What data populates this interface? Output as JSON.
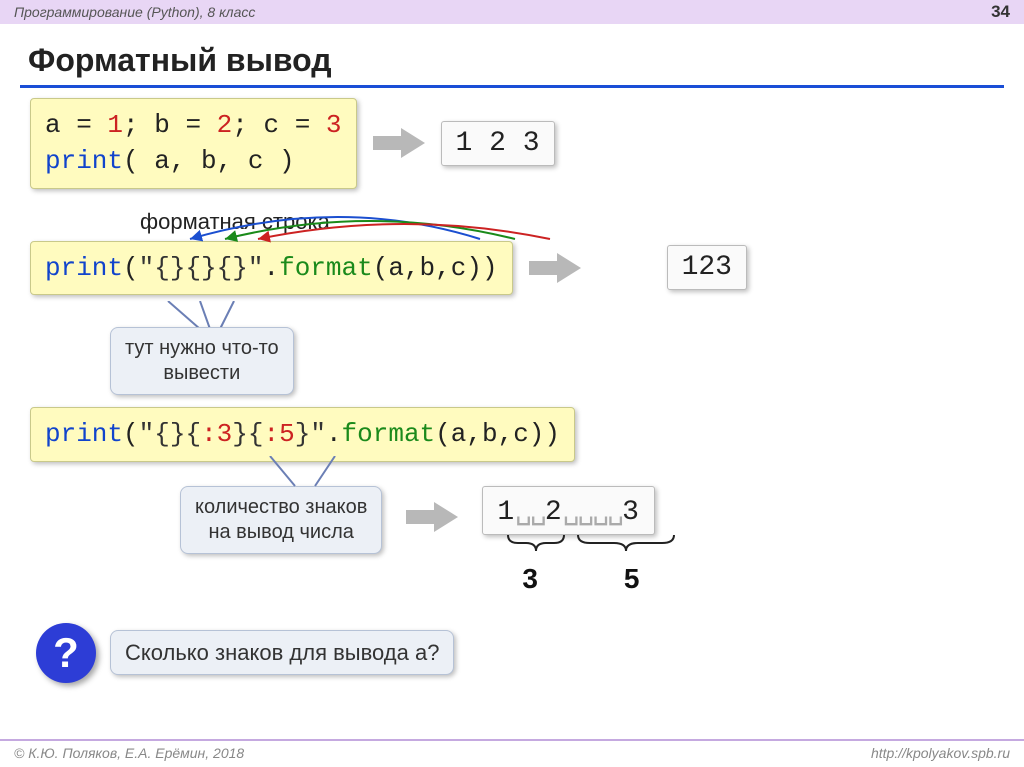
{
  "header": {
    "course": "Программирование (Python), 8 класс",
    "page": "34"
  },
  "title": "Форматный вывод",
  "block1": {
    "code": {
      "a": "a",
      "eq1": " = ",
      "v1": "1",
      "sc1": "; ",
      "b": "b",
      "eq2": " = ",
      "v2": "2",
      "sc2": "; ",
      "c": "c",
      "eq3": " = ",
      "v3": "3",
      "print": "print",
      "args": "( a, b, c )"
    },
    "output": "1 2 3"
  },
  "format_string_label": "форматная строка",
  "block2": {
    "print": "print",
    "open": "(",
    "q1": "\"",
    "b1": "{}",
    "b2": "{}",
    "b3": "{}",
    "q2": "\"",
    "dot": ".",
    "format": "format",
    "open2": "(",
    "args": "a,b,c",
    "close2": ")",
    "close": ")",
    "output": "123"
  },
  "callout_explain": "тут нужно что-то\nвывести",
  "block3": {
    "print": "print",
    "open": "(",
    "q1": "\"",
    "b1o": "{",
    "b1c": "}",
    "b2o": "{",
    "b2n": ":3",
    "b2c": "}",
    "b3o": "{",
    "b3n": ":5",
    "b3c": "}",
    "q2": "\"",
    "dot": ".",
    "format": "format",
    "open2": "(",
    "args": "a,b,c",
    "close2": ")",
    "close": ")"
  },
  "callout_width": "количество знаков\nна вывод числа",
  "output3": {
    "one": "1",
    "spaces3": "␣␣",
    "two": "2",
    "spaces5": "␣␣␣␣",
    "three": "3",
    "label3": "3",
    "label5": "5"
  },
  "question": {
    "mark": "?",
    "text": "Сколько знаков для вывода a?"
  },
  "footer": {
    "left": "© К.Ю. Поляков, Е.А. Ерёмин, 2018",
    "right": "http://kpolyakov.spb.ru"
  }
}
